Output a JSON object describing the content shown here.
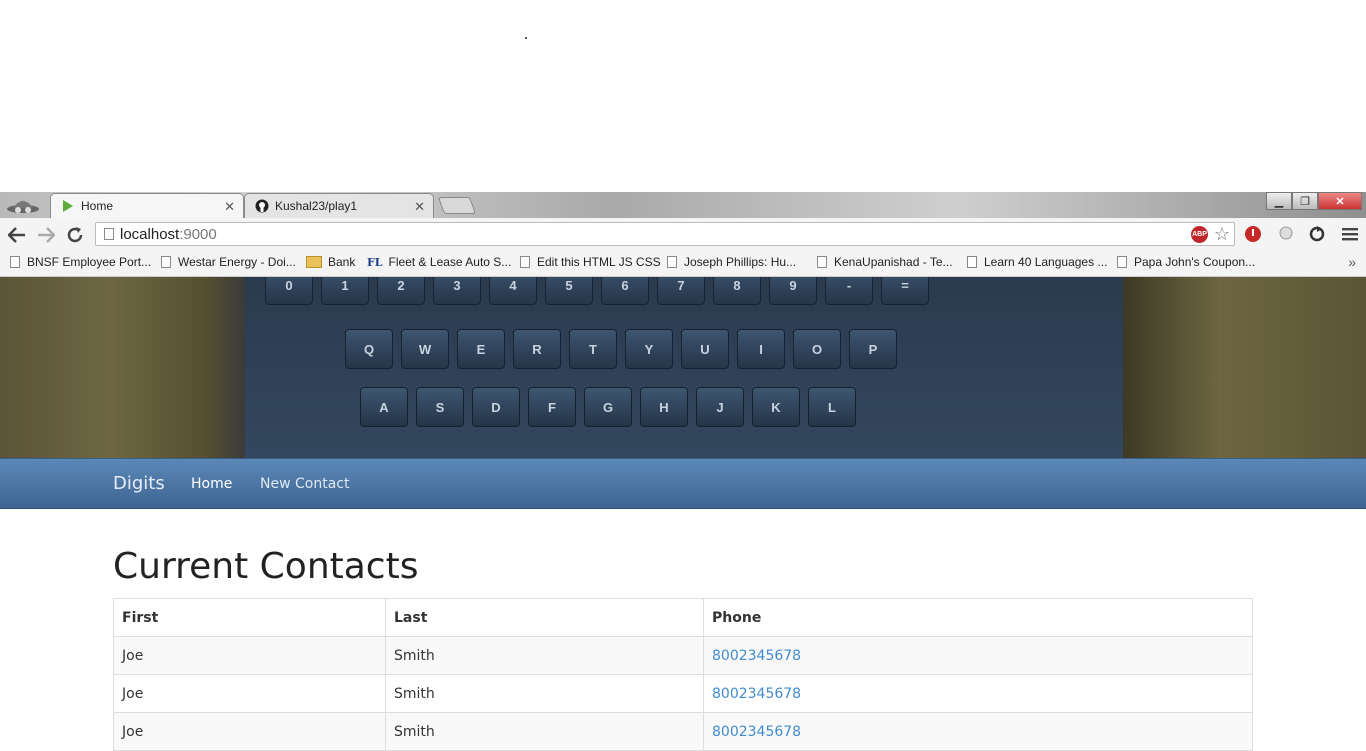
{
  "browser": {
    "tabs": [
      {
        "title": "Home",
        "active": true
      },
      {
        "title": "Kushal23/play1",
        "active": false
      }
    ],
    "address": {
      "host": "localhost",
      "port": ":9000"
    },
    "bookmarks": [
      {
        "label": "BNSF Employee Port...",
        "icon": "page-icon"
      },
      {
        "label": "Westar Energy - Doi...",
        "icon": "page-icon"
      },
      {
        "label": "Bank",
        "icon": "folder-icon"
      },
      {
        "label": "Fleet & Lease Auto S...",
        "icon": "fl-icon",
        "icon_text": "FL"
      },
      {
        "label": "Edit this HTML JS CSS",
        "icon": "page-icon"
      },
      {
        "label": "Joseph Phillips: Hu...",
        "icon": "page-icon"
      },
      {
        "label": "KenaUpanishad - Te...",
        "icon": "page-icon"
      },
      {
        "label": "Learn 40 Languages ...",
        "icon": "page-icon"
      },
      {
        "label": "Papa John's Coupon...",
        "icon": "page-icon"
      }
    ],
    "more_bookmarks": "»",
    "extensions": {
      "abp": "ABP"
    }
  },
  "banner": {
    "rows": [
      [
        "0",
        "1",
        "2",
        "3",
        "4",
        "5",
        "6",
        "7",
        "8",
        "9",
        "-",
        "="
      ],
      [
        "Q",
        "W",
        "E",
        "R",
        "T",
        "Y",
        "U",
        "I",
        "O",
        "P"
      ],
      [
        "A",
        "S",
        "D",
        "F",
        "G",
        "H",
        "J",
        "K",
        "L"
      ]
    ]
  },
  "navbar": {
    "brand": "Digits",
    "links": [
      {
        "label": "Home",
        "active": true
      },
      {
        "label": "New Contact",
        "active": false
      }
    ]
  },
  "page": {
    "title": "Current Contacts",
    "table": {
      "headers": [
        "First",
        "Last",
        "Phone"
      ],
      "rows": [
        {
          "first": "Joe",
          "last": "Smith",
          "phone": "8002345678"
        },
        {
          "first": "Joe",
          "last": "Smith",
          "phone": "8002345678"
        },
        {
          "first": "Joe",
          "last": "Smith",
          "phone": "8002345678"
        }
      ]
    }
  }
}
